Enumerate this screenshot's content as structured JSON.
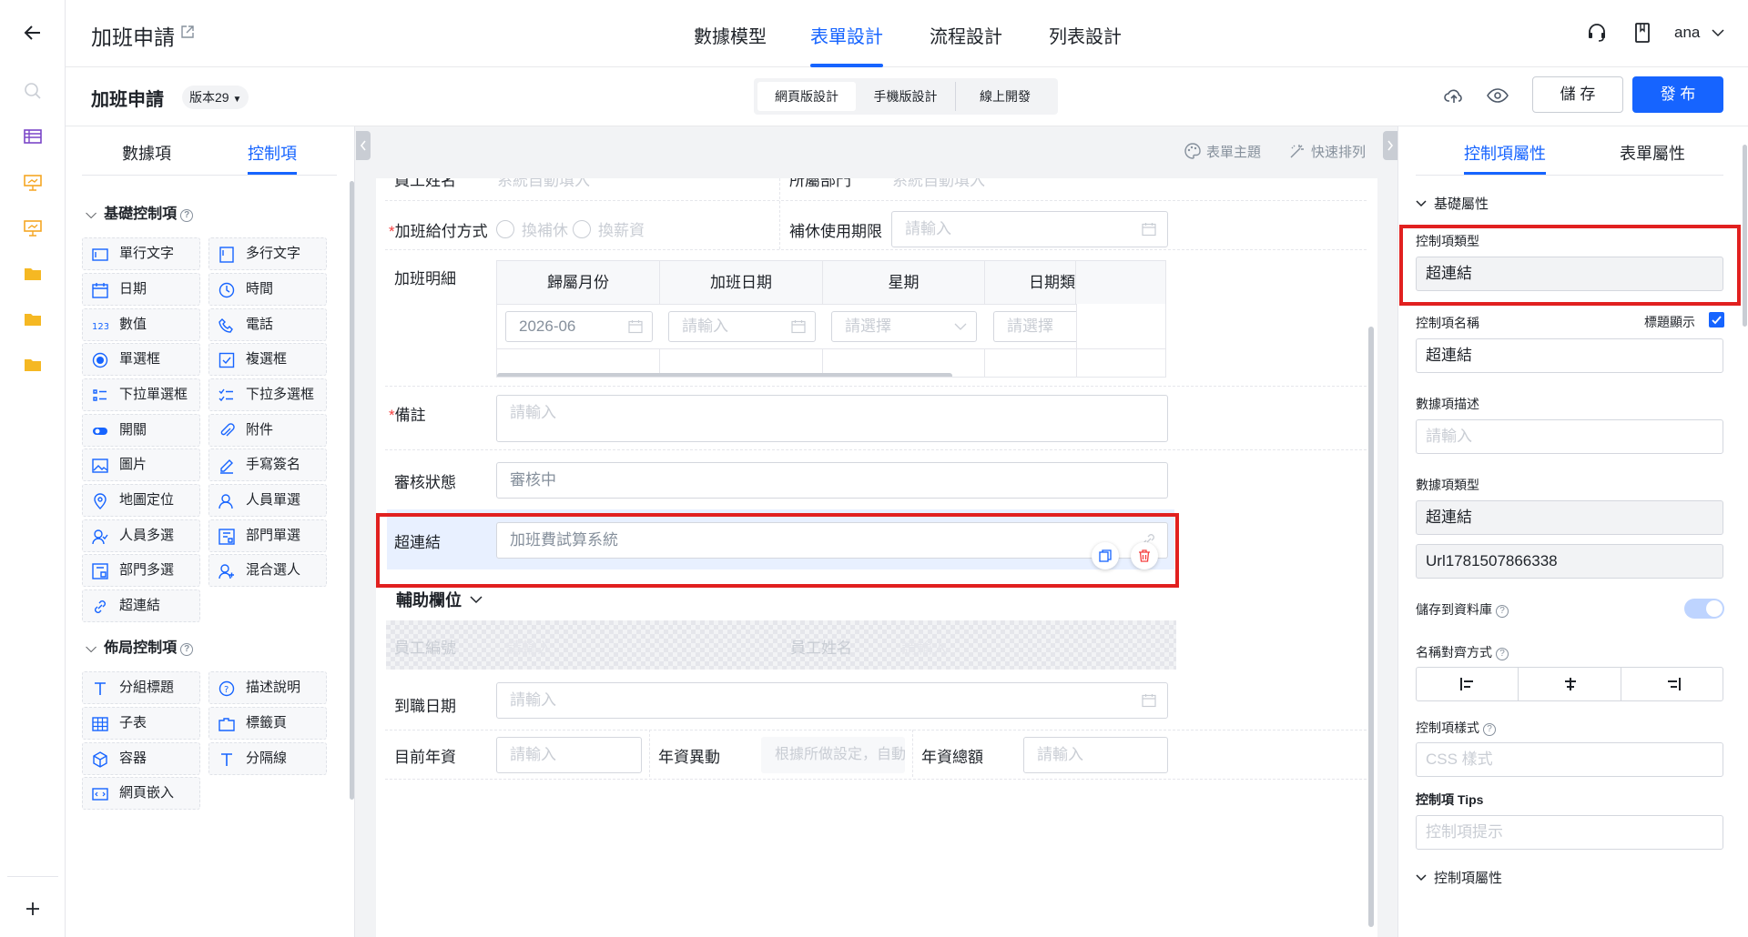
{
  "topbar": {
    "title": "加班申請",
    "tabs": [
      "數據模型",
      "表單設計",
      "流程設計",
      "列表設計"
    ],
    "active_tab": "表單設計",
    "user": "ana"
  },
  "subbar": {
    "form_name": "加班申請",
    "version": "版本29",
    "modes": [
      "網頁版設計",
      "手機版設計",
      "線上開發"
    ],
    "active_mode": "網頁版設計",
    "save_label": "儲 存",
    "publish_label": "發 布"
  },
  "left_panel": {
    "tabs": [
      "數據項",
      "控制項"
    ],
    "active_tab": "控制項",
    "basic_section": "基礎控制項",
    "basic_items": [
      "單行文字",
      "多行文字",
      "日期",
      "時間",
      "數值",
      "電話",
      "單選框",
      "複選框",
      "下拉單選框",
      "下拉多選框",
      "開關",
      "附件",
      "圖片",
      "手寫簽名",
      "地圖定位",
      "人員單選",
      "人員多選",
      "部門單選",
      "部門多選",
      "混合選人",
      "超連結"
    ],
    "layout_section": "佈局控制項",
    "layout_items": [
      "分組標題",
      "描述說明",
      "子表",
      "標籤頁",
      "容器",
      "分隔線",
      "網頁嵌入"
    ]
  },
  "canvas": {
    "toolbar": {
      "theme": "表單主題",
      "arrange": "快速排列"
    },
    "top_cut_left_label": "員工姓名",
    "top_cut_left_value": "系統自動填入",
    "top_cut_right_label": "所屬部門",
    "top_cut_right_value": "系統自動填入",
    "pay_label": "加班給付方式",
    "pay_options": [
      "換補休",
      "換薪資"
    ],
    "comp_label": "補休使用期限",
    "comp_placeholder": "請輸入",
    "detail_label": "加班明細",
    "detail_headers": [
      "歸屬月份",
      "加班日期",
      "星期",
      "日期類"
    ],
    "detail_values": [
      "2026-06",
      "請輸入",
      "請選擇",
      "請選擇"
    ],
    "remark_label": "備註",
    "remark_placeholder": "請輸入",
    "status_label": "審核狀態",
    "status_value": "審核中",
    "link_label": "超連結",
    "link_value": "加班費試算系統",
    "aux_title": "輔助欄位",
    "aux_emp_no_label": "員工編號",
    "aux_emp_no_value": "請輸入",
    "aux_emp_name_label": "員工姓名",
    "aux_emp_name_value": "請輸入",
    "join_label": "到職日期",
    "join_placeholder": "請輸入",
    "salary_label": "目前年資",
    "salary_placeholder": "請輸入",
    "change_label": "年資異動",
    "change_value": "根據所做設定，自動...",
    "total_label": "年資總額",
    "total_placeholder": "請輸入"
  },
  "right_panel": {
    "tabs": [
      "控制項屬性",
      "表單屬性"
    ],
    "active_tab": "控制項屬性",
    "basic_section": "基礎屬性",
    "type_label": "控制項類型",
    "type_value": "超連結",
    "name_label": "控制項名稱",
    "title_show_label": "標題顯示",
    "title_show_checked": true,
    "name_value": "超連結",
    "desc_label": "數據項描述",
    "desc_placeholder": "請輸入",
    "dtype_label": "數據項類型",
    "dtype_value": "超連結",
    "field_id": "Url1781507866338",
    "store_label": "儲存到資料庫",
    "store_on": true,
    "align_label": "名稱對齊方式",
    "style_label": "控制項樣式",
    "style_placeholder": "CSS 樣式",
    "tips_label": "控制項 Tips",
    "tips_placeholder": "控制項提示",
    "ctrl_section": "控制項屬性"
  },
  "colors": {
    "accent": "#1664ff",
    "highlight": "#e1201f",
    "required": "#f53f3f"
  }
}
